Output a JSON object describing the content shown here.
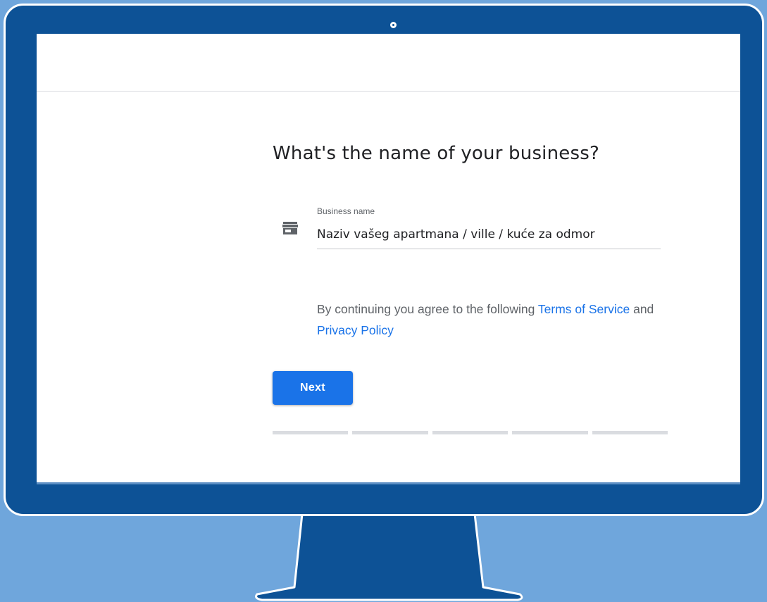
{
  "colors": {
    "background": "#6fa6dc",
    "monitor": "#0d5296",
    "accent": "#1a73e8",
    "text_primary": "#202124",
    "text_secondary": "#5f6368"
  },
  "icons": {
    "field_icon": "store-icon"
  },
  "form": {
    "title": "What's the name of your business?",
    "business_name_label": "Business name",
    "business_name_value": "Naziv vašeg apartmana / ville / kuće za odmor",
    "terms": {
      "prefix": "By continuing you agree to the following ",
      "terms_link": "Terms of Service",
      "middle": " and ",
      "privacy_link": "Privacy Policy"
    },
    "next_label": "Next"
  },
  "progress": {
    "total_steps": 5
  }
}
